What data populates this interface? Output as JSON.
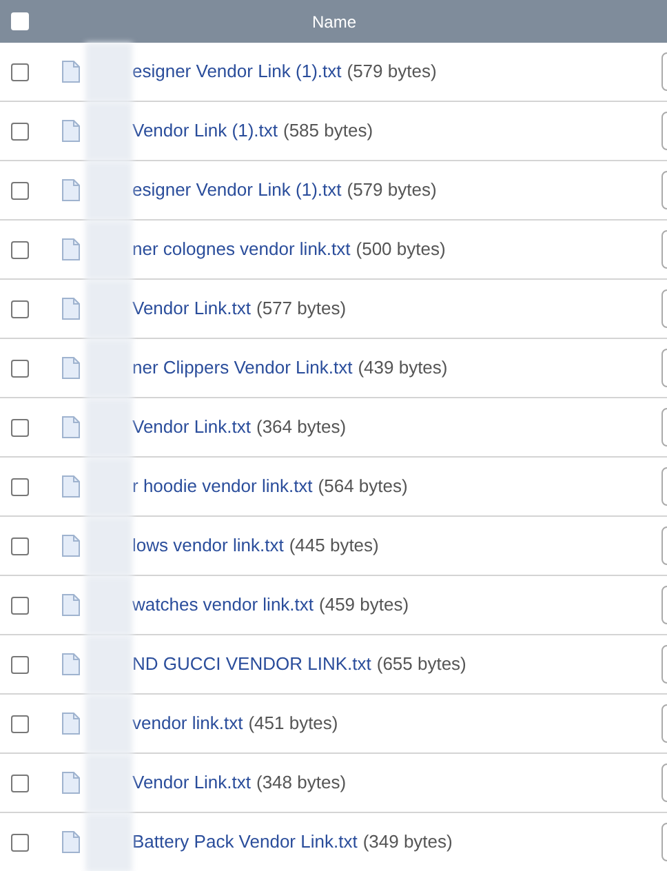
{
  "table": {
    "select_all": {
      "checked": false
    },
    "columns": [
      "Name"
    ],
    "rows": [
      {
        "checked": false,
        "name": "esigner Vendor Link (1).txt",
        "size": "(579 bytes)"
      },
      {
        "checked": false,
        "name": "Vendor Link (1).txt",
        "size": "(585 bytes)"
      },
      {
        "checked": false,
        "name": "esigner Vendor Link (1).txt",
        "size": "(579 bytes)"
      },
      {
        "checked": false,
        "name": "ner colognes vendor link.txt",
        "size": "(500 bytes)"
      },
      {
        "checked": false,
        "name": "Vendor Link.txt",
        "size": "(577 bytes)"
      },
      {
        "checked": false,
        "name": "ner Clippers Vendor Link.txt",
        "size": "(439 bytes)"
      },
      {
        "checked": false,
        "name": "Vendor Link.txt",
        "size": "(364 bytes)"
      },
      {
        "checked": false,
        "name": "r hoodie vendor link.txt",
        "size": "(564 bytes)"
      },
      {
        "checked": false,
        "name": "lows vendor link.txt",
        "size": "(445 bytes)"
      },
      {
        "checked": false,
        "name": "watches vendor link.txt",
        "size": "(459 bytes)"
      },
      {
        "checked": false,
        "name": "ND GUCCI VENDOR LINK.txt",
        "size": "(655 bytes)"
      },
      {
        "checked": false,
        "name": "vendor link.txt",
        "size": "(451 bytes)"
      },
      {
        "checked": false,
        "name": "Vendor Link.txt",
        "size": "(348 bytes)"
      },
      {
        "checked": false,
        "name": "Battery Pack Vendor Link.txt",
        "size": "(349 bytes)"
      }
    ]
  }
}
